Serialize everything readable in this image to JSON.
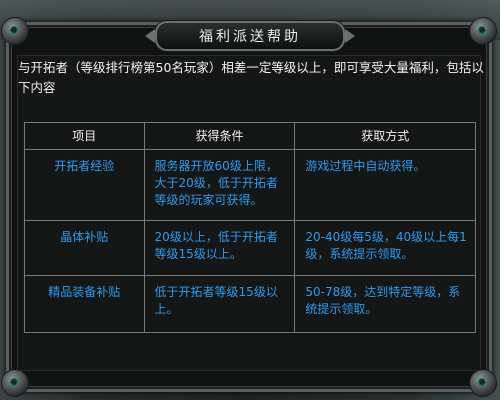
{
  "window": {
    "title": "福利派送帮助"
  },
  "intro": {
    "text": "与开拓者（等级排行榜第50名玩家）相差一定等级以上，即可享受大量福利，包括以下内容"
  },
  "table": {
    "headers": [
      "项目",
      "获得条件",
      "获取方式"
    ],
    "rows": [
      {
        "item": "开拓者经验",
        "condition": "服务器开放60级上限，大于20级，低于开拓者等级的玩家可获得。",
        "method": "游戏过程中自动获得。"
      },
      {
        "item": "晶体补贴",
        "condition": "20级以上，低于开拓者等级15级以上。",
        "method": "20-40级每5级，40级以上每1级，系统提示领取。"
      },
      {
        "item": "精品装备补贴",
        "condition": "低于开拓者等级15级以上。",
        "method": "50-78级，达到特定等级，系统提示领取。"
      }
    ]
  },
  "colors": {
    "panel_bg": "#111313",
    "frame": "#5a5f5f",
    "header_text": "#f0f0f0",
    "cell_text": "#2f9bf0",
    "grid_line": "#757a7a"
  }
}
